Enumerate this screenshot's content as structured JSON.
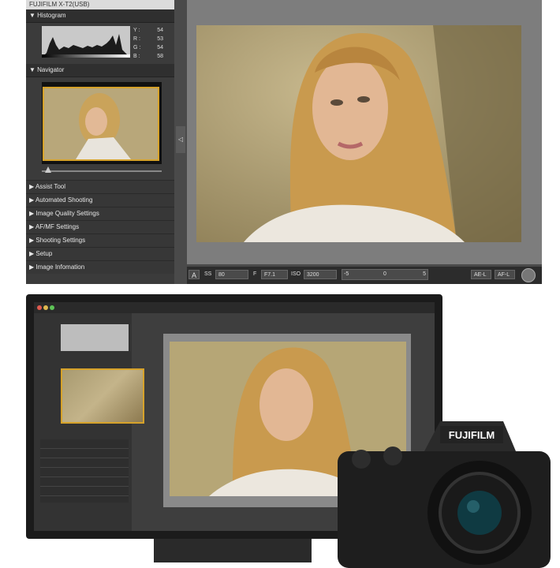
{
  "top": {
    "camera_title": "FUJIFILM X-T2(USB)",
    "histogram": {
      "label": "Histogram",
      "values": [
        {
          "ch": "Y :",
          "v": "54"
        },
        {
          "ch": "R :",
          "v": "53"
        },
        {
          "ch": "G :",
          "v": "54"
        },
        {
          "ch": "B :",
          "v": "58"
        }
      ]
    },
    "navigator": {
      "label": "Navigator"
    },
    "menu": [
      "Assist Tool",
      "Automated Shooting",
      "Image Quality Settings",
      "AF/MF Settings",
      "Shooting Settings",
      "Setup",
      "Image Infomation"
    ],
    "collapse_glyph": "◁",
    "bottom_bar": {
      "mode": "A",
      "ss_label": "SS",
      "ss_value": "80",
      "f_label": "F",
      "f_value": "F7.1",
      "iso_label": "ISO",
      "iso_value": "3200",
      "ev_minus": "-5",
      "ev_zero": "0",
      "ev_plus": "5",
      "afl1": "AE-L",
      "afl2": "AF-L"
    }
  },
  "bottom": {
    "brand": "FUJIFILM"
  },
  "colors": {
    "accent": "#d6a22a",
    "panel": "#3b3b3b",
    "viewer": "#7d7d7d"
  }
}
